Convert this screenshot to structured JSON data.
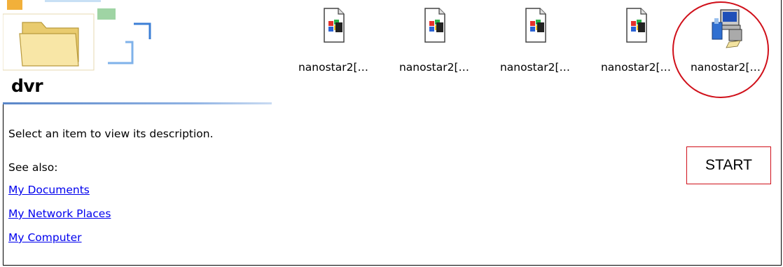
{
  "folder": {
    "title": "dvr",
    "description": "Select an item to view its description.",
    "see_also_label": "See also:",
    "links": [
      "My Documents",
      "My Network Places",
      "My Computer"
    ]
  },
  "items": [
    {
      "label": "nanostar2[…",
      "icon": "installer-file-icon"
    },
    {
      "label": "nanostar2[…",
      "icon": "installer-file-icon"
    },
    {
      "label": "nanostar2[…",
      "icon": "installer-file-icon"
    },
    {
      "label": "nanostar2[…",
      "icon": "installer-file-icon"
    },
    {
      "label": "nanostar2[…",
      "icon": "setup-program-icon"
    }
  ],
  "annotation": {
    "start_label": "START",
    "highlight_color": "#d0101a"
  },
  "colors": {
    "link": "#0000ee",
    "divider": "#5a86c8"
  }
}
